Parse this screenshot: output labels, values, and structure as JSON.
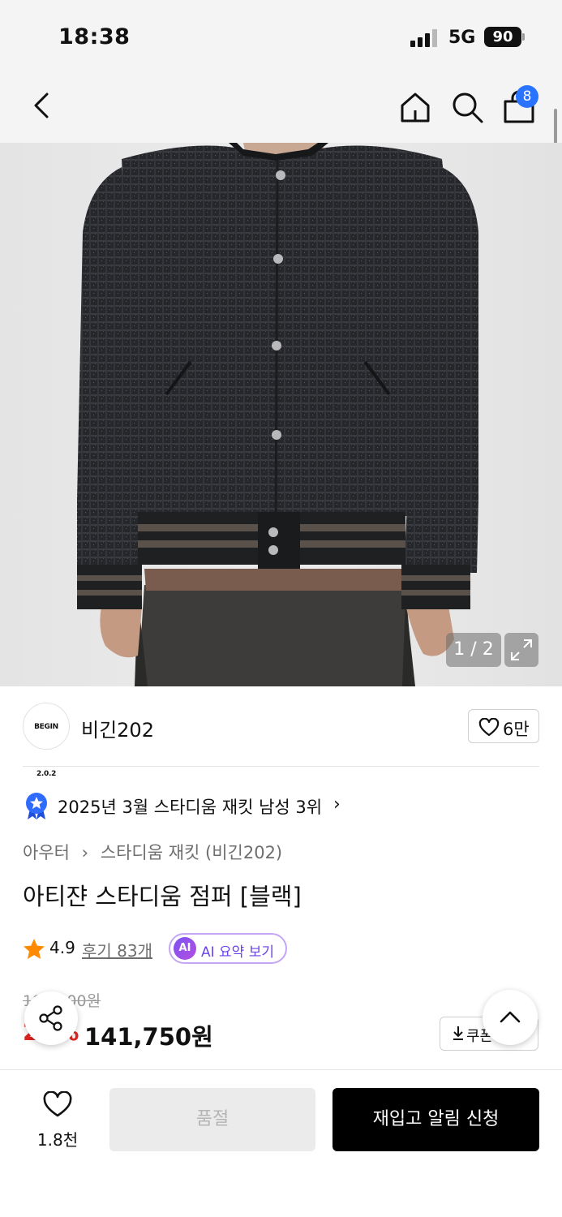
{
  "status_bar": {
    "time": "18:38",
    "network": "5G",
    "battery": "90"
  },
  "nav": {
    "cart_count": "8"
  },
  "gallery": {
    "counter": "1 / 2"
  },
  "brand": {
    "logo_text": "BEGIN 2.0.2",
    "name": "비긴202",
    "like_count": "6만"
  },
  "ranking": {
    "text": "2025년 3월 스타디움 재킷 남성 3위",
    "chevron": "›"
  },
  "breadcrumb": {
    "category": "아우터",
    "separator": "›",
    "subcategory": "스타디움 재킷 (비긴202)"
  },
  "product": {
    "title": "아티쟌 스타디움 점퍼 [블랙]"
  },
  "rating": {
    "value": "4.9",
    "reviews_label": "후기 83개",
    "ai_badge": "AI",
    "ai_summary_label": "AI 요약 보기"
  },
  "price": {
    "original": "189,000원",
    "discount": "25%",
    "sale": "141,750원",
    "coupon_label": "쿠폰"
  },
  "bottom_bar": {
    "wish_count": "1.8천",
    "soldout_label": "품절",
    "restock_label": "재입고 알림 신청"
  }
}
